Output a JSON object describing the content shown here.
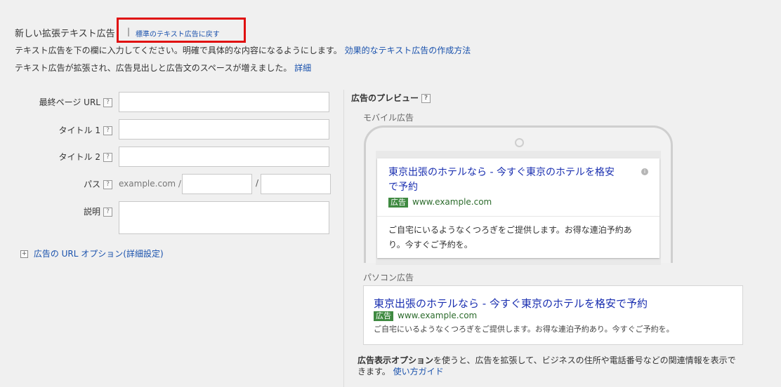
{
  "header": {
    "title": "新しい拡張テキスト広告",
    "separator": "|",
    "revert_link": "標準のテキスト広告に戻す",
    "instruction": "テキスト広告を下の欄に入力してください。明確で具体的な内容になるようにします。",
    "instruction_link": "効果的なテキスト広告の作成方法",
    "note": "テキスト広告が拡張され、広告見出しと広告文のスペースが増えました。",
    "note_link": "詳細"
  },
  "form": {
    "final_url_label": "最終ページ URL",
    "final_url_value": "",
    "title1_label": "タイトル 1",
    "title1_value": "",
    "title2_label": "タイトル 2",
    "title2_value": "",
    "path_label": "パス",
    "path_domain": "example.com /",
    "path_sep": "/",
    "path1_value": "",
    "path2_value": "",
    "description_label": "説明",
    "description_value": "",
    "help_glyph": "?",
    "url_options_toggle": "⊞",
    "url_options_label": "広告の URL オプション(詳細設定)"
  },
  "preview": {
    "title": "広告のプレビュー",
    "mobile_label": "モバイル広告",
    "mobile_headline_line1": "東京出張のホテルなら - 今すぐ東京のホテルを格安",
    "mobile_headline_line2": "で予約",
    "ad_badge": "広告",
    "display_url": "www.example.com",
    "mobile_description_line1": "ご自宅にいるようなくつろぎをご提供します。お得な連泊予約あ",
    "mobile_description_line2": "り。今すぐご予約を。",
    "desktop_label": "パソコン広告",
    "desktop_headline": "東京出張のホテルなら - 今すぐ東京のホテルを格安で予約",
    "desktop_description": "ご自宅にいるようなくつろぎをご提供します。お得な連泊予約あり。今すぐご予約を。",
    "footer_bold": "広告表示オプション",
    "footer_text_line1": "を使うと、広告を拡張して、ビジネスの住所や電話番号などの関連情報を表示で",
    "footer_text_line2": "きます。",
    "footer_link": "使い方ガイド",
    "info_glyph": "i"
  },
  "colors": {
    "link": "#1a52ad",
    "highlight": "#e01010",
    "ad_badge": "#3f8a41"
  }
}
